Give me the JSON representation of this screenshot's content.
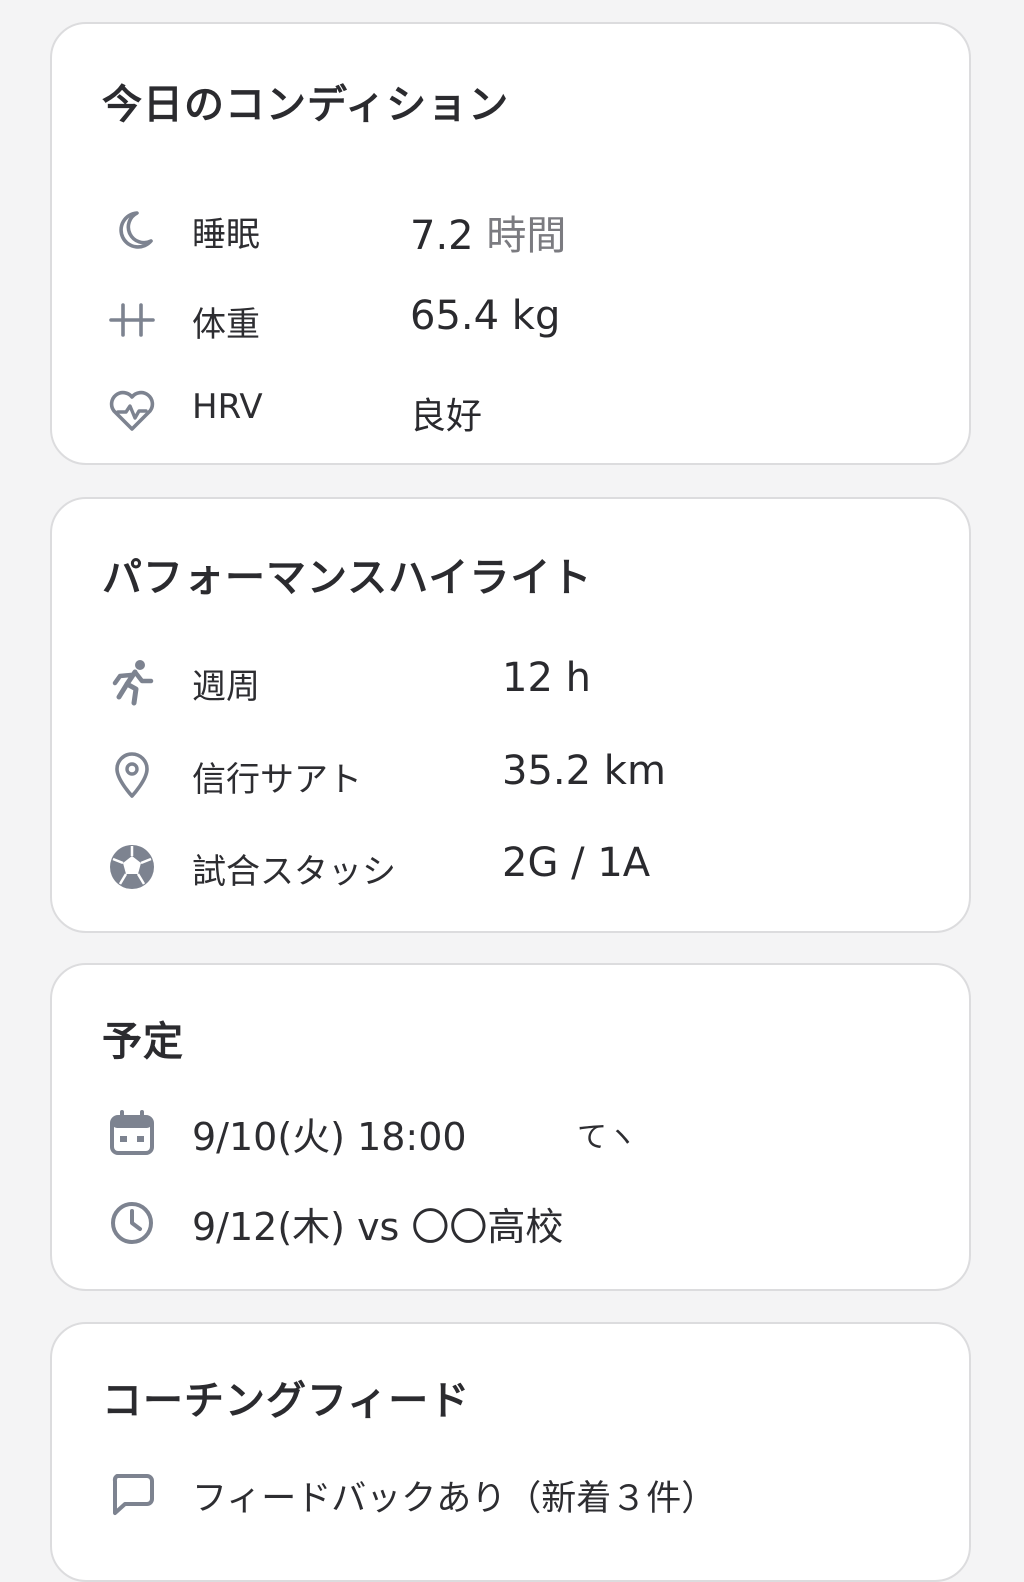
{
  "condition": {
    "title": "今日のコンディション",
    "rows": [
      {
        "icon": "moon-icon",
        "label": "睡眠",
        "value": "7.2",
        "unit": "時間"
      },
      {
        "icon": "weight-icon",
        "label": "体重",
        "value": "65.4 kg"
      },
      {
        "icon": "heart-pulse-icon",
        "label": "HRV",
        "value": "良好"
      }
    ]
  },
  "performance": {
    "title": "パフォーマンスハイライト",
    "rows": [
      {
        "icon": "running-icon",
        "label": "週周",
        "value": "12 h"
      },
      {
        "icon": "location-pin-icon",
        "label": "信行サアト",
        "value": "35.2 km"
      },
      {
        "icon": "soccer-ball-icon",
        "label": "試合スタッシ",
        "value": "2G / 1A"
      }
    ]
  },
  "schedule": {
    "title": "予定",
    "rows": [
      {
        "icon": "calendar-icon",
        "text": "9/10(火) 18:00",
        "aside": "てヽ"
      },
      {
        "icon": "clock-icon",
        "text": "9/12(木) vs 〇〇高校"
      }
    ]
  },
  "coaching": {
    "title": "コーチングフィード",
    "rows": [
      {
        "icon": "chat-bubble-icon",
        "text": "フィードバックあり（新着３件）"
      }
    ]
  },
  "colors": {
    "background": "#f4f4f5",
    "card": "#ffffff",
    "border": "#dcdcde",
    "icon": "#7d8390",
    "text": "#2a2a2e",
    "muted": "#7b7b80"
  }
}
